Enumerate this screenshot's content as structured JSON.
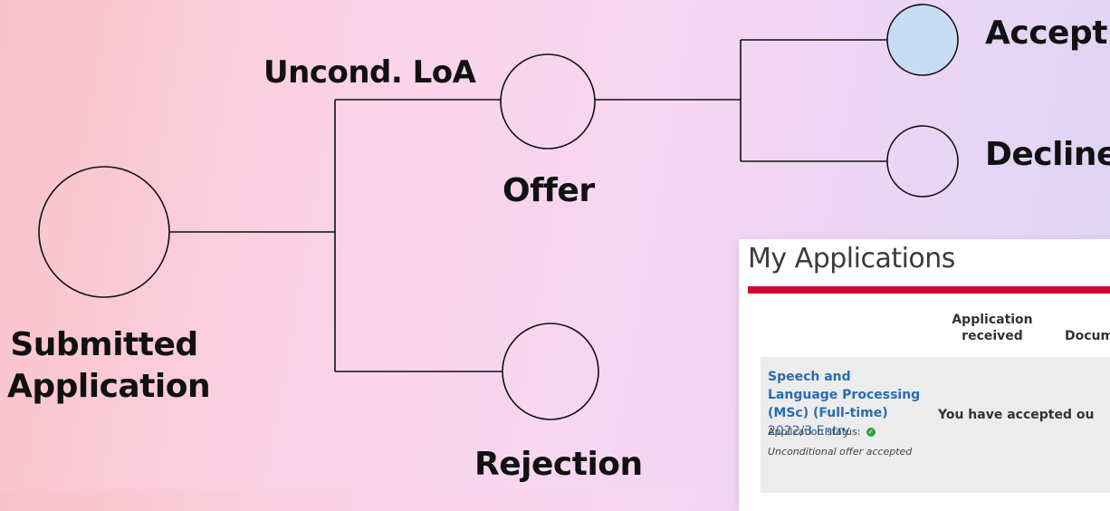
{
  "nodes": {
    "submitted": "Submitted\nApplication",
    "offer": "Offer",
    "rejection": "Rejection",
    "accept": "Accept",
    "decline": "Decline"
  },
  "edges": {
    "offer_branch": "Uncond. LoA"
  },
  "colors": {
    "accept_fill": "#c8dcf6",
    "node_stroke": "#111111",
    "brand_red": "#d50032",
    "link_blue": "#2b6cb0"
  },
  "portal": {
    "title": "My Applications",
    "columns": [
      "Application received",
      "Docume"
    ],
    "application": {
      "programme": "Speech and Language Processing (MSc) (Full-time)",
      "entry": "2022/3 Entry",
      "status_label": "Application status:",
      "status_icon": "check-circle-icon",
      "status_note": "Unconditional offer accepted",
      "message": "You have accepted ou"
    }
  }
}
